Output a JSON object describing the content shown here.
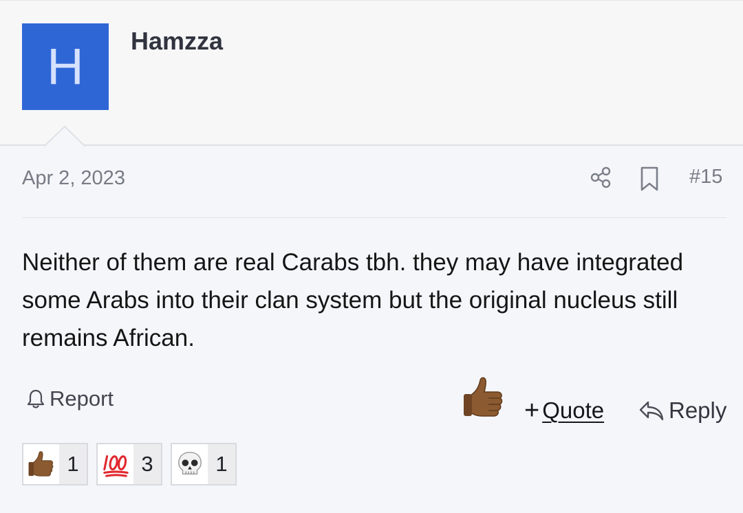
{
  "post": {
    "author": {
      "initial": "H",
      "name": "Hamzza",
      "avatar_color": "#2f66d6"
    },
    "date": "Apr 2, 2023",
    "post_number": "#15",
    "body": "Neither of them are real Carabs tbh. they may have integrated some Arabs into their clan system but the original nucleus still remains African.",
    "actions": {
      "report_label": "Report",
      "quote_plus": "+",
      "quote_label": "Quote",
      "reply_label": "Reply",
      "like_icon": "thumbs-up-medium-dark-skin-emoji"
    },
    "reactions": [
      {
        "icon": "thumbs-up-emoji",
        "count": "1"
      },
      {
        "icon": "hundred-points-emoji",
        "count": "3"
      },
      {
        "icon": "skull-emoji",
        "count": "1"
      }
    ]
  }
}
